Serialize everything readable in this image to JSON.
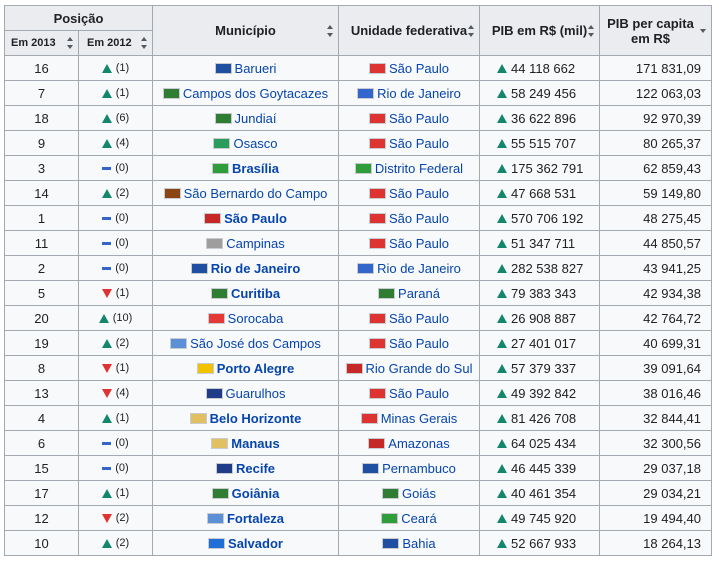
{
  "headers": {
    "posicao": "Posição",
    "em2013": "Em 2013",
    "em2012": "Em 2012",
    "municipio": "Município",
    "uf": "Unidade federativa",
    "pib": "PIB em R$ (mil)",
    "pib_pc": "PIB per capita em R$"
  },
  "rows": [
    {
      "pos2013": "16",
      "trend": "up",
      "pos2012": "(1)",
      "municipio": "Barueri",
      "bold": false,
      "mflag": "#1f4fa0",
      "uf": "São Paulo",
      "uflag": "#d33",
      "pib": "44 118 662",
      "pib_pc": "171 831,09"
    },
    {
      "pos2013": "7",
      "trend": "up",
      "pos2012": "(1)",
      "municipio": "Campos dos Goytacazes",
      "bold": false,
      "mflag": "#2e7d32",
      "uf": "Rio de Janeiro",
      "uflag": "#36c",
      "pib": "58 249 456",
      "pib_pc": "122 063,03"
    },
    {
      "pos2013": "18",
      "trend": "up",
      "pos2012": "(6)",
      "municipio": "Jundiaí",
      "bold": false,
      "mflag": "#2e7d32",
      "uf": "São Paulo",
      "uflag": "#d33",
      "pib": "36 622 896",
      "pib_pc": "92 970,39"
    },
    {
      "pos2013": "9",
      "trend": "up",
      "pos2012": "(4)",
      "municipio": "Osasco",
      "bold": false,
      "mflag": "#2a9d5c",
      "uf": "São Paulo",
      "uflag": "#d33",
      "pib": "55 515 707",
      "pib_pc": "80 265,37"
    },
    {
      "pos2013": "3",
      "trend": "same",
      "pos2012": "(0)",
      "municipio": "Brasília",
      "bold": true,
      "mflag": "#2e9d3a",
      "uf": "Distrito Federal",
      "uflag": "#2e9d3a",
      "pib": "175 362 791",
      "pib_pc": "62 859,43"
    },
    {
      "pos2013": "14",
      "trend": "up",
      "pos2012": "(2)",
      "municipio": "São Bernardo do Campo",
      "bold": false,
      "mflag": "#8b4513",
      "uf": "São Paulo",
      "uflag": "#d33",
      "pib": "47 668 531",
      "pib_pc": "59 149,80"
    },
    {
      "pos2013": "1",
      "trend": "same",
      "pos2012": "(0)",
      "municipio": "São Paulo",
      "bold": true,
      "mflag": "#c62828",
      "uf": "São Paulo",
      "uflag": "#d33",
      "pib": "570 706 192",
      "pib_pc": "48 275,45"
    },
    {
      "pos2013": "11",
      "trend": "same",
      "pos2012": "(0)",
      "municipio": "Campinas",
      "bold": false,
      "mflag": "#9e9e9e",
      "uf": "São Paulo",
      "uflag": "#d33",
      "pib": "51 347 711",
      "pib_pc": "44 850,57"
    },
    {
      "pos2013": "2",
      "trend": "same",
      "pos2012": "(0)",
      "municipio": "Rio de Janeiro",
      "bold": true,
      "mflag": "#1f4fa0",
      "uf": "Rio de Janeiro",
      "uflag": "#36c",
      "pib": "282 538 827",
      "pib_pc": "43 941,25"
    },
    {
      "pos2013": "5",
      "trend": "down",
      "pos2012": "(1)",
      "municipio": "Curitiba",
      "bold": true,
      "mflag": "#2e7d32",
      "uf": "Paraná",
      "uflag": "#2e7d32",
      "pib": "79 383 343",
      "pib_pc": "42 934,38"
    },
    {
      "pos2013": "20",
      "trend": "up",
      "pos2012": "(10)",
      "municipio": "Sorocaba",
      "bold": false,
      "mflag": "#e53935",
      "uf": "São Paulo",
      "uflag": "#d33",
      "pib": "26 908 887",
      "pib_pc": "42 764,72"
    },
    {
      "pos2013": "19",
      "trend": "up",
      "pos2012": "(2)",
      "municipio": "São José dos Campos",
      "bold": false,
      "mflag": "#5b8fd6",
      "uf": "São Paulo",
      "uflag": "#d33",
      "pib": "27 401 017",
      "pib_pc": "40 699,31"
    },
    {
      "pos2013": "8",
      "trend": "down",
      "pos2012": "(1)",
      "municipio": "Porto Alegre",
      "bold": true,
      "mflag": "#f2c200",
      "uf": "Rio Grande do Sul",
      "uflag": "#c62828",
      "pib": "57 379 337",
      "pib_pc": "39 091,64"
    },
    {
      "pos2013": "13",
      "trend": "down",
      "pos2012": "(4)",
      "municipio": "Guarulhos",
      "bold": false,
      "mflag": "#1f3c88",
      "uf": "São Paulo",
      "uflag": "#d33",
      "pib": "49 392 842",
      "pib_pc": "38 016,46"
    },
    {
      "pos2013": "4",
      "trend": "up",
      "pos2012": "(1)",
      "municipio": "Belo Horizonte",
      "bold": true,
      "mflag": "#e0c060",
      "uf": "Minas Gerais",
      "uflag": "#d33",
      "pib": "81 426 708",
      "pib_pc": "32 844,41"
    },
    {
      "pos2013": "6",
      "trend": "same",
      "pos2012": "(0)",
      "municipio": "Manaus",
      "bold": true,
      "mflag": "#e0c060",
      "uf": "Amazonas",
      "uflag": "#c62828",
      "pib": "64 025 434",
      "pib_pc": "32 300,56"
    },
    {
      "pos2013": "15",
      "trend": "same",
      "pos2012": "(0)",
      "municipio": "Recife",
      "bold": true,
      "mflag": "#1f3c88",
      "uf": "Pernambuco",
      "uflag": "#1f4fa0",
      "pib": "46 445 339",
      "pib_pc": "29 037,18"
    },
    {
      "pos2013": "17",
      "trend": "up",
      "pos2012": "(1)",
      "municipio": "Goiânia",
      "bold": true,
      "mflag": "#2e7d32",
      "uf": "Goiás",
      "uflag": "#2e7d32",
      "pib": "40 461 354",
      "pib_pc": "29 034,21"
    },
    {
      "pos2013": "12",
      "trend": "down",
      "pos2012": "(2)",
      "municipio": "Fortaleza",
      "bold": true,
      "mflag": "#5b8fd6",
      "uf": "Ceará",
      "uflag": "#2e9d3a",
      "pib": "49 745 920",
      "pib_pc": "19 494,40"
    },
    {
      "pos2013": "10",
      "trend": "up",
      "pos2012": "(2)",
      "municipio": "Salvador",
      "bold": true,
      "mflag": "#1f6fd6",
      "uf": "Bahia",
      "uflag": "#1f4fa0",
      "pib": "52 667 933",
      "pib_pc": "18 264,13"
    }
  ]
}
